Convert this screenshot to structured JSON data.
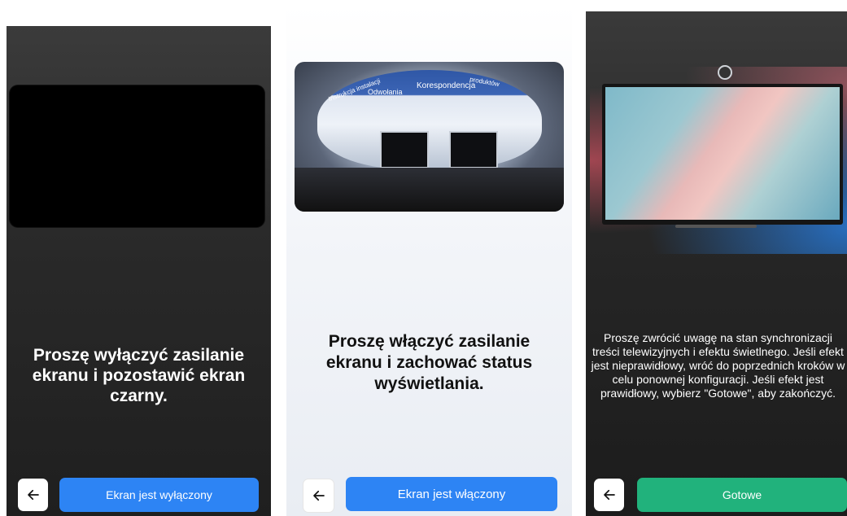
{
  "panels": [
    {
      "message": "Proszę wyłączyć zasilanie ekranu i pozostawić ekran czarny.",
      "button_label": "Ekran jest wyłączony",
      "back_icon": "arrow-left-icon",
      "button_color": "#2d84f4"
    },
    {
      "message": "Proszę włączyć zasilanie ekranu i zachować status wyświetlania.",
      "button_label": "Ekran jest włączony",
      "back_icon": "arrow-left-icon",
      "button_color": "#2d84f4",
      "photo_labels": [
        "Odwołania",
        "Korespondencja",
        "Instrukcja instalacji",
        "produktów"
      ]
    },
    {
      "message": "Proszę zwrócić uwagę na stan synchronizacji treści telewizyjnych i efektu świetlnego. Jeśli efekt jest nieprawidłowy, wróć do poprzednich kroków w celu ponownej konfiguracji. Jeśli efekt jest prawidłowy, wybierz \"Gotowe\", aby zakończyć.",
      "button_label": "Gotowe",
      "back_icon": "arrow-left-icon",
      "button_color": "#21b27c"
    }
  ]
}
